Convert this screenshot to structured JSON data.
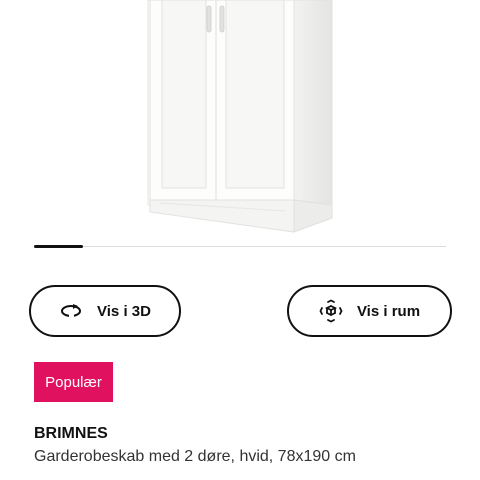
{
  "product_image": {
    "icon": "wardrobe-image"
  },
  "carousel": {
    "progress": 0.12
  },
  "actions": {
    "view_3d": {
      "label": "Vis i 3D",
      "icon": "rotate-3d-icon"
    },
    "view_room": {
      "label": "Vis i rum",
      "icon": "ar-cube-icon"
    }
  },
  "badge": {
    "label": "Populær",
    "color": "#e0115f"
  },
  "product": {
    "name": "BRIMNES",
    "description": "Garderobeskab med 2 døre, hvid, 78x190 cm"
  }
}
